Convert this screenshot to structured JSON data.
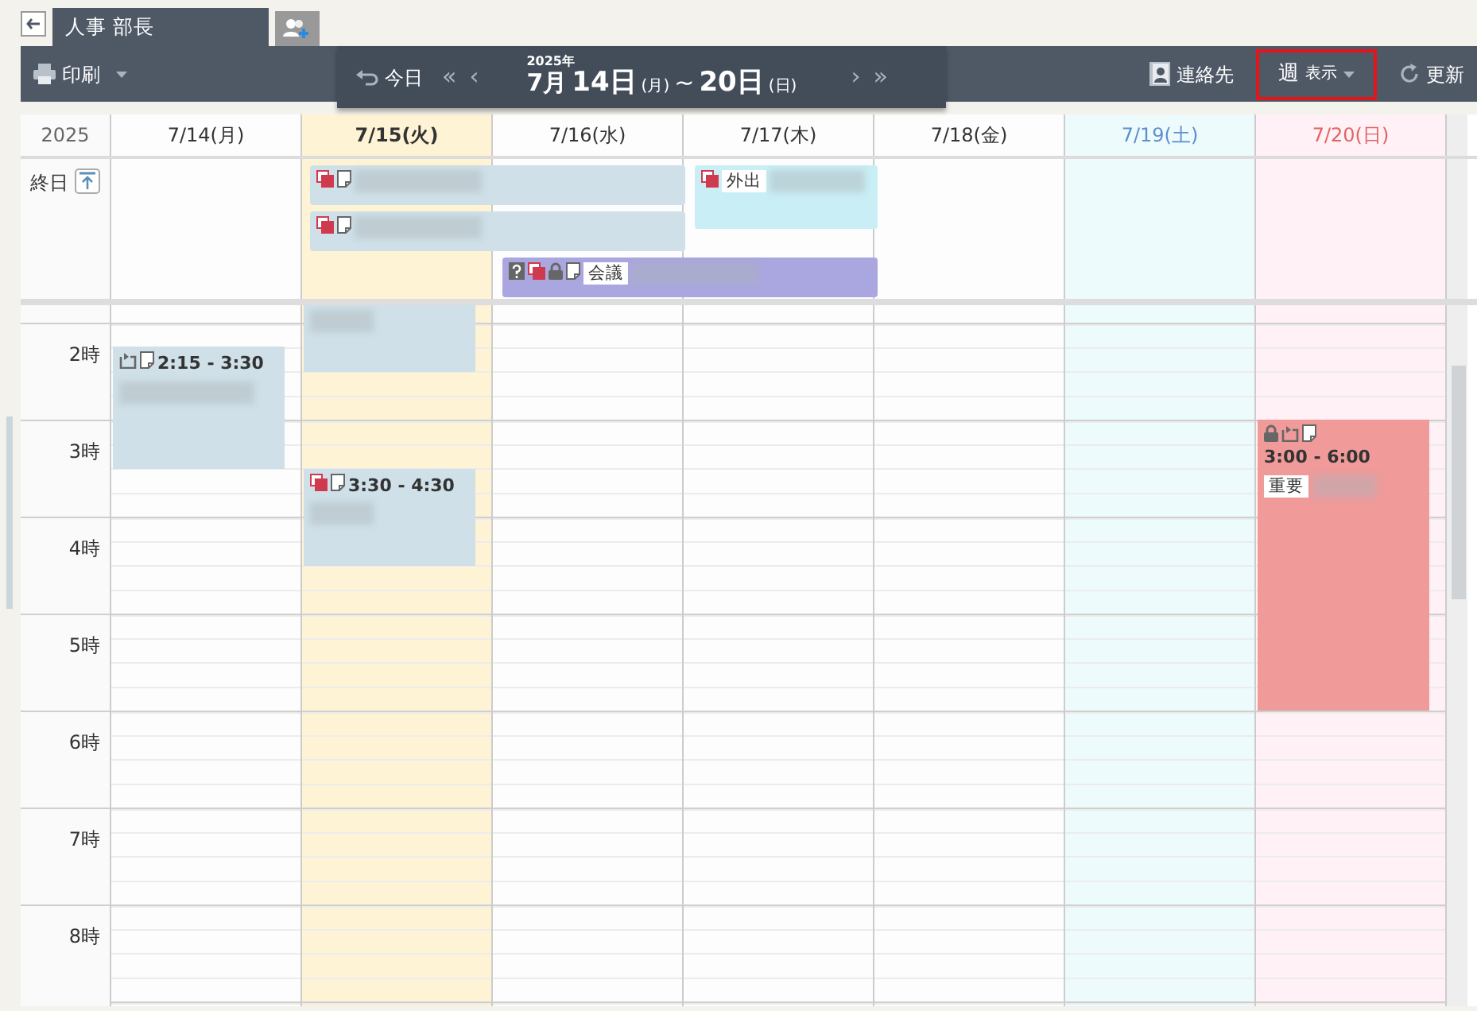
{
  "tabs": [
    {
      "kind": "user",
      "label": "人事 部長",
      "selected": true
    },
    {
      "kind": "add-user",
      "selected": false
    }
  ],
  "toolbar": {
    "print": "印刷",
    "today": "今日",
    "prev_month": "«",
    "prev_week": "‹",
    "next_week": "›",
    "next_month": "»",
    "year": "2025年",
    "range": {
      "start_month": "7月",
      "start_day": "14日",
      "start_weekday": "(月)",
      "separator": "~",
      "end_day": "20日",
      "end_weekday": "(日)"
    },
    "contacts": "連絡先",
    "view": {
      "label": "週",
      "sub": "表示",
      "highlighted": true
    },
    "refresh": "更新"
  },
  "calendar": {
    "year": "2025",
    "all_day_label": "終日",
    "days": [
      {
        "label": "7/14(月)",
        "kind": "weekday",
        "today": false,
        "events": [
          {
            "time": "2:15 - 3:30",
            "color": "#cfe0e8",
            "repeat": true,
            "memo": true
          }
        ]
      },
      {
        "label": "7/15(火)",
        "kind": "weekday",
        "today": true,
        "events": [
          {
            "color": "#cfe0e8"
          },
          {
            "time": "3:30 - 4:30",
            "color": "#cfe0e8",
            "shared": true,
            "memo": true
          }
        ]
      },
      {
        "label": "7/16(水)",
        "kind": "weekday",
        "today": false
      },
      {
        "label": "7/17(木)",
        "kind": "weekday",
        "today": false
      },
      {
        "label": "7/18(金)",
        "kind": "weekday",
        "today": false
      },
      {
        "label": "7/19(土)",
        "kind": "saturday",
        "today": false
      },
      {
        "label": "7/20(日)",
        "kind": "sunday",
        "today": false,
        "events": [
          {
            "time": "3:00 - 6:00",
            "color": "#f09a9a",
            "private": true,
            "repeat": true,
            "memo": true,
            "tag": "重要"
          }
        ]
      }
    ],
    "all_day_events": [
      {
        "color": "#cfe0e8",
        "shared": true,
        "memo": true
      },
      {
        "color": "#cfe0e8",
        "shared": true,
        "memo": true
      },
      {
        "color": "#c9eef5",
        "shared": true,
        "tag": "外出"
      },
      {
        "color": "#aaa6e0",
        "unconfirmed": true,
        "shared": true,
        "private": true,
        "memo": true,
        "tag": "会議"
      }
    ],
    "hours": [
      "2時",
      "3時",
      "4時",
      "5時",
      "6時",
      "7時",
      "8時"
    ]
  }
}
